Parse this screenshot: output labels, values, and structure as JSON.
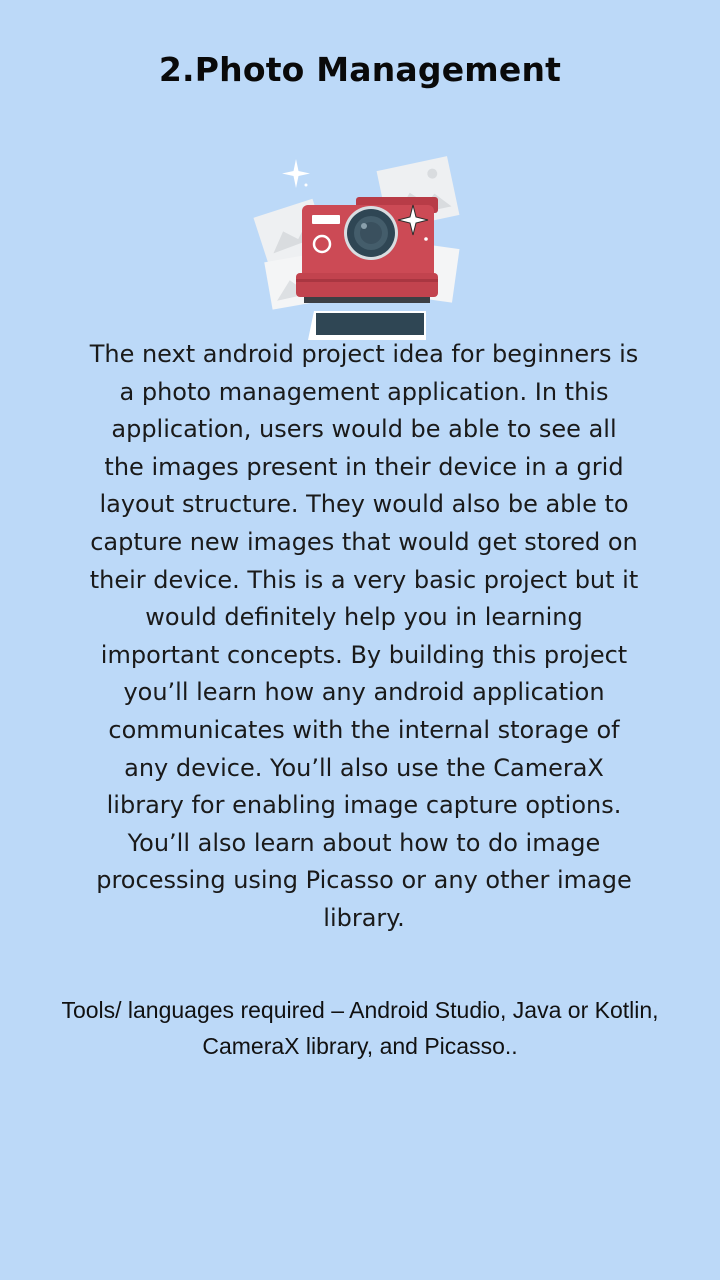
{
  "slide": {
    "title": "2.Photo Management",
    "body": "The next android project idea for beginners is a photo management application. In this application, users would be able to see all the images present in their device in a grid layout structure. They would also be able to capture new images that would get stored on their device. This is a very basic project but it would definitely help you in learning important concepts. By building this project you’ll learn how any android application communicates with the internal storage of any device. You’ll also use the CameraX library for enabling image capture options. You’ll also learn about how to do image processing using Picasso or any other image library.",
    "tools": "Tools/ languages required – Android Studio, Java or Kotlin, CameraX library, and Picasso.."
  },
  "illustration": {
    "icon": "instant-camera-icon",
    "camera_color": "#cc4a55",
    "lens_color": "#2f4654",
    "photo_color": "#eef0f2"
  },
  "colors": {
    "background": "#bcd9f8",
    "text": "#1a1a1a"
  }
}
